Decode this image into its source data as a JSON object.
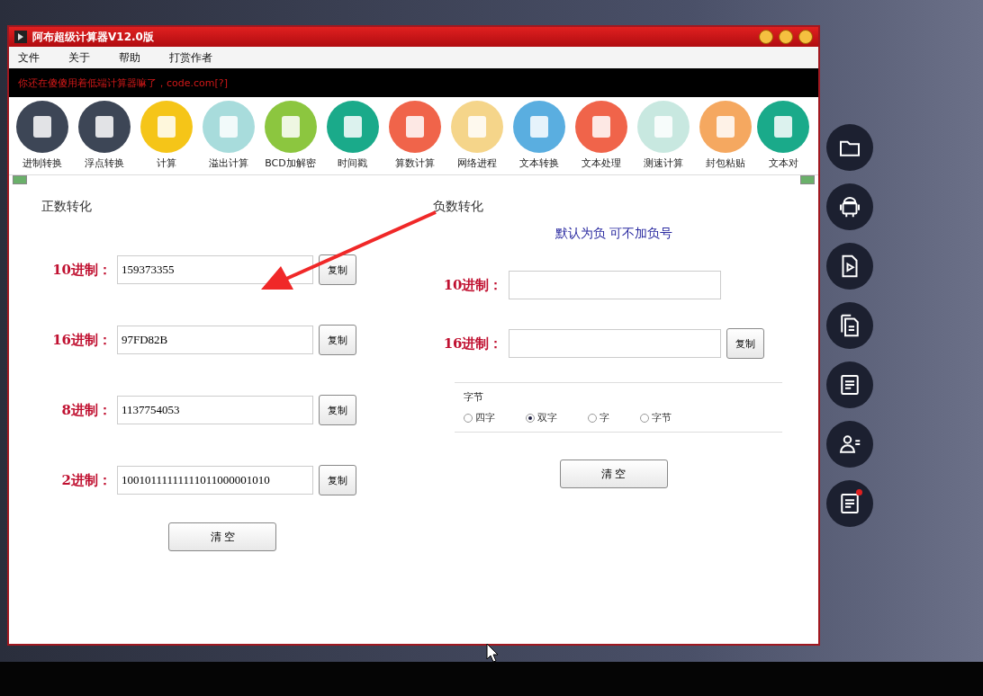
{
  "window": {
    "title": "阿布超级计算器V12.0版"
  },
  "menu": [
    "文件",
    "关于",
    "帮助",
    "打赏作者"
  ],
  "banner": "你还在傻傻用着低端计算器嘛了，code.com[?]",
  "toolbar": [
    {
      "label": "进制转换",
      "color": "#3d4656"
    },
    {
      "label": "浮点转换",
      "color": "#3d4656"
    },
    {
      "label": "计算",
      "color": "#f5c518"
    },
    {
      "label": "溢出计算",
      "color": "#a8dcdc"
    },
    {
      "label": "BCD加解密",
      "color": "#8cc63f"
    },
    {
      "label": "时间戳",
      "color": "#1aaa8a"
    },
    {
      "label": "算数计算",
      "color": "#f0644a"
    },
    {
      "label": "网络进程",
      "color": "#f5d58a"
    },
    {
      "label": "文本转换",
      "color": "#5aaee0"
    },
    {
      "label": "文本处理",
      "color": "#f0644a"
    },
    {
      "label": "测速计算",
      "color": "#c8e8e0"
    },
    {
      "label": "封包粘贴",
      "color": "#f5a860"
    },
    {
      "label": "文本对",
      "color": "#1aaa8a"
    }
  ],
  "positive": {
    "title": "正数转化",
    "rows": [
      {
        "label": "10进制：",
        "value": "159373355",
        "copy": "复制"
      },
      {
        "label": "16进制：",
        "value": "97FD82B",
        "copy": "复制"
      },
      {
        "label": "8进制：",
        "value": "1137754053",
        "copy": "复制"
      },
      {
        "label": "2进制：",
        "value": "10010111111111011000001010",
        "copy": "复制"
      }
    ],
    "clear": "清 空"
  },
  "negative": {
    "title": "负数转化",
    "hint": "默认为负 可不加负号",
    "rows": [
      {
        "label": "10进制："
      },
      {
        "label": "16进制：",
        "copy": "复制"
      }
    ],
    "group_title": "字节",
    "options": [
      {
        "label": "四字",
        "selected": false
      },
      {
        "label": "双字",
        "selected": true
      },
      {
        "label": "字",
        "selected": false
      },
      {
        "label": "字节",
        "selected": false
      }
    ],
    "clear": "清 空"
  },
  "side_buttons": [
    {
      "kind": "folder",
      "badge": false
    },
    {
      "kind": "android",
      "badge": false
    },
    {
      "kind": "video",
      "badge": false
    },
    {
      "kind": "copy",
      "badge": false
    },
    {
      "kind": "notes",
      "badge": false
    },
    {
      "kind": "contact",
      "badge": false
    },
    {
      "kind": "notes",
      "badge": true
    }
  ]
}
